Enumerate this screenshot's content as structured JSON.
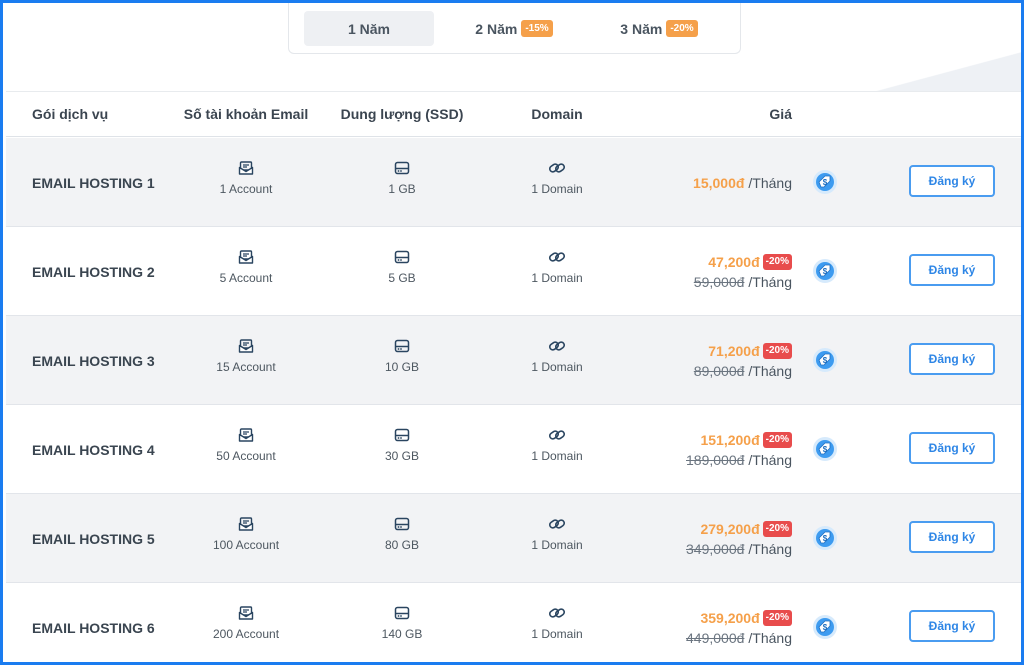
{
  "tabs": [
    {
      "label": "1 Năm",
      "badge": ""
    },
    {
      "label": "2 Năm",
      "badge": "-15%"
    },
    {
      "label": "3 Năm",
      "badge": "-20%"
    }
  ],
  "active_tab": 0,
  "header": {
    "package": "Gói dịch vụ",
    "accounts": "Số tài khoản Email",
    "storage": "Dung lượng (SSD)",
    "domain": "Domain",
    "price": "Giá"
  },
  "rows": [
    {
      "name": "EMAIL HOSTING 1",
      "accounts": "1 Account",
      "storage": "1 GB",
      "domain": "1 Domain",
      "price": "15,000đ",
      "sale": "",
      "old_price": "",
      "unit": "/Tháng",
      "button": "Đăng ký"
    },
    {
      "name": "EMAIL HOSTING 2",
      "accounts": "5 Account",
      "storage": "5 GB",
      "domain": "1 Domain",
      "price": "47,200đ",
      "sale": "-20%",
      "old_price": "59,000đ",
      "unit": "/Tháng",
      "button": "Đăng ký"
    },
    {
      "name": "EMAIL HOSTING 3",
      "accounts": "15 Account",
      "storage": "10 GB",
      "domain": "1 Domain",
      "price": "71,200đ",
      "sale": "-20%",
      "old_price": "89,000đ",
      "unit": "/Tháng",
      "button": "Đăng ký"
    },
    {
      "name": "EMAIL HOSTING 4",
      "accounts": "50 Account",
      "storage": "30 GB",
      "domain": "1 Domain",
      "price": "151,200đ",
      "sale": "-20%",
      "old_price": "189,000đ",
      "unit": "/Tháng",
      "button": "Đăng ký"
    },
    {
      "name": "EMAIL HOSTING 5",
      "accounts": "100 Account",
      "storage": "80 GB",
      "domain": "1 Domain",
      "price": "279,200đ",
      "sale": "-20%",
      "old_price": "349,000đ",
      "unit": "/Tháng",
      "button": "Đăng ký"
    },
    {
      "name": "EMAIL HOSTING 6",
      "accounts": "200 Account",
      "storage": "140 GB",
      "domain": "1 Domain",
      "price": "359,200đ",
      "sale": "-20%",
      "old_price": "449,000đ",
      "unit": "/Tháng",
      "button": "Đăng ký"
    }
  ],
  "icons": {
    "accounts": "mail-icon",
    "storage": "hard-drive-icon",
    "domain": "link-icon",
    "price_info": "price-tag-coin-icon"
  },
  "colors": {
    "frame": "#1a7cf0",
    "price": "#f5a04a",
    "sale_badge": "#e84c4c",
    "tab_badge": "#f5a04a",
    "button": "#2e86e6"
  }
}
